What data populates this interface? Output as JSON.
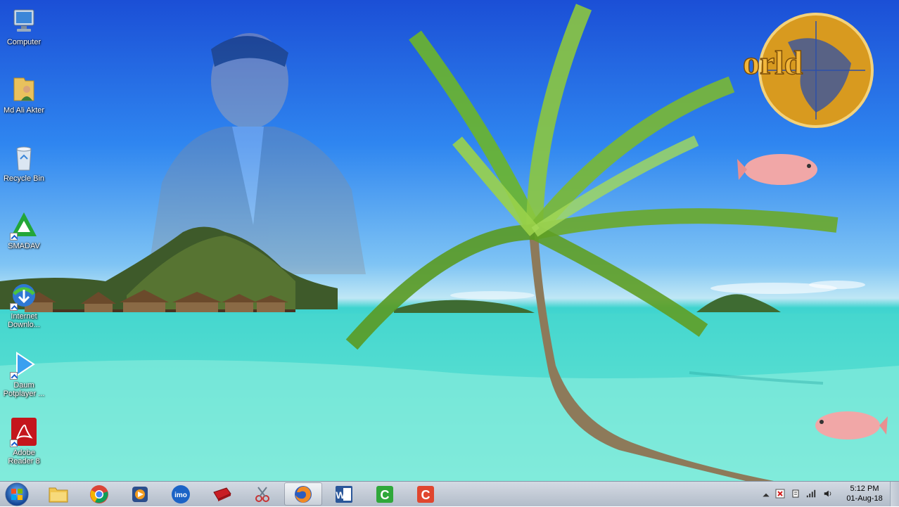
{
  "desktop_icons": [
    {
      "label": "Computer",
      "icon": "computer-icon"
    },
    {
      "label": "Md Ali Akter",
      "icon": "user-folder-icon"
    },
    {
      "label": "Recycle Bin",
      "icon": "recycle-bin-icon"
    },
    {
      "label": "SMADAV",
      "icon": "smadav-icon"
    },
    {
      "label": "Internet Downlo...",
      "icon": "internet-download-manager-icon"
    },
    {
      "label": "Daum Potplayer ...",
      "icon": "potplayer-icon"
    },
    {
      "label": "Adobe Reader 8",
      "icon": "adobe-reader-icon"
    }
  ],
  "wallpaper": {
    "logo_text": "orld"
  },
  "taskbar": {
    "start_icon": "windows-start-icon",
    "pinned": [
      {
        "name": "file-explorer",
        "icon": "folder-icon"
      },
      {
        "name": "chrome",
        "icon": "chrome-icon"
      },
      {
        "name": "media-player",
        "icon": "media-player-icon"
      },
      {
        "name": "imo",
        "icon": "imo-icon",
        "text": "imo"
      },
      {
        "name": "book-app",
        "icon": "red-book-icon"
      },
      {
        "name": "snipping-tool",
        "icon": "scissors-icon"
      },
      {
        "name": "firefox",
        "icon": "firefox-icon",
        "active": true
      },
      {
        "name": "word",
        "icon": "word-icon",
        "text": "W"
      },
      {
        "name": "camtasia-green",
        "icon": "camtasia-green-icon",
        "text": "C"
      },
      {
        "name": "camtasia-red",
        "icon": "camtasia-red-icon",
        "text": "C"
      }
    ]
  },
  "tray": {
    "icons": [
      "show-hidden-icons-arrow",
      "alert-flag-icon",
      "action-center-icon",
      "network-signal-icon",
      "volume-icon"
    ],
    "time": "5:12 PM",
    "date": "01-Aug-18"
  },
  "colors": {
    "accent": "#1b4fd6",
    "taskbar": "#c3cbd6",
    "sea": "#5fe0d4"
  }
}
